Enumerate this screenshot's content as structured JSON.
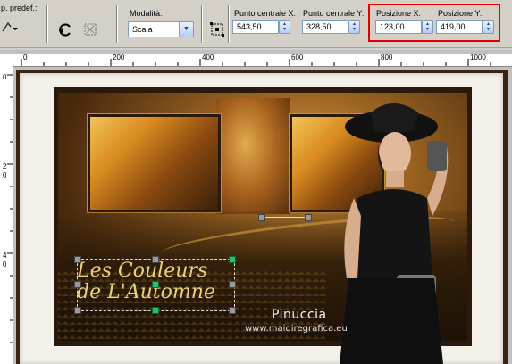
{
  "toolbar": {
    "preset_label": "p. predef.:",
    "mode_label": "Modalità:",
    "mode_value": "Scala",
    "center_x_label": "Punto centrale X:",
    "center_x_value": "543,50",
    "center_y_label": "Punto centrale Y:",
    "center_y_value": "328,50",
    "pos_x_label": "Posizione X:",
    "pos_x_value": "123,00",
    "pos_y_label": "Posizione Y:",
    "pos_y_value": "419,00",
    "highlight_color": "#e00000"
  },
  "ruler": {
    "h_ticks": [
      "0",
      "200",
      "400",
      "600",
      "800",
      "1000"
    ],
    "v_ticks": [
      "0",
      "2",
      "0",
      "4",
      "0"
    ]
  },
  "artwork": {
    "title_line1": "Les Couleurs",
    "title_line2": "de L'Automne",
    "signature": "Pinuccia",
    "website": "www.maidiregrafica.eu"
  }
}
